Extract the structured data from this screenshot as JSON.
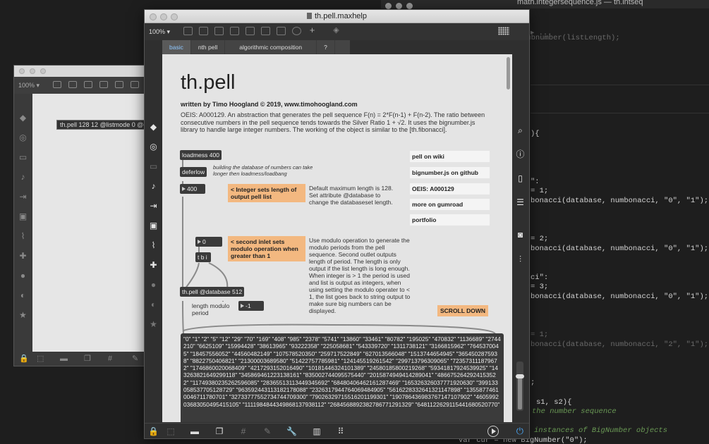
{
  "code_editor": {
    "title": "math.integersequence.js — th.intseq",
    "lines": [
      {
        "text": "▸ ..."
      },
      {
        "text": "'ubnumber(listLength);"
      },
      {
        "text": "){"
      },
      {
        "text": "\":"
      },
      {
        "text": "= 1;"
      },
      {
        "text": "bonacci(database, numbonacci, \"0\", \"1\");"
      },
      {
        "text": "= 2;"
      },
      {
        "text": "bonacci(database, numbonacci, \"0\", \"1\");"
      },
      {
        "text": "ci\":"
      },
      {
        "text": "= 3;"
      },
      {
        "text": "bonacci(database, numbonacci, \"0\", \"1\");"
      },
      {
        "text": "= 1;"
      },
      {
        "text": "bonacci(database, numbonacci, \"2\", \"1\");"
      },
      {
        "text": ";"
      },
      {
        "text": "s1, s2){"
      },
      {
        "text": "the number sequence"
      },
      {
        "text": "instances of BigNumber objects"
      },
      {
        "text": "var cur = new BigNumber(\"0\");"
      }
    ]
  },
  "back_window": {
    "zoom": "100% ▾",
    "object_text": "th.pell 128 12 @listmode 0 @c"
  },
  "help_window": {
    "title": "th.pell.maxhelp",
    "zoom": "100% ▾",
    "tabs": [
      {
        "label": "basic"
      },
      {
        "label": "nth pell"
      },
      {
        "label": "algorithmic composition"
      },
      {
        "label": "?"
      }
    ],
    "canvas": {
      "heading": "th.pell",
      "byline": "written by Timo Hoogland © 2019, www.timohoogland.com",
      "description": "OEIS: A000129. An abstraction that generates the pell sequence F(n) = 2*F(n-1) + F(n-2). The ratio between consecutive numbers in the pell sequence tends towards the Silver Ratio 1 + √2. It uses the bignumber.js library to handle large integer numbers. The working of the object is similar to the [th.fibonacci].",
      "loadmess": "loadmess 400",
      "deferlow": "deferlow",
      "defer_note": "building the database of numbers can take longer then loadmess/loadbang",
      "num_400": "400",
      "integer_comment": "< Integer sets length of output pell list",
      "integer_note": "Default maximum length is 128. Set attribute @database to change the databaseset length.",
      "num_0": "0",
      "tbi": "t b i",
      "modulo_comment": "< second inlet sets modulo operation when greater than 1",
      "modulo_note": "Use modulo operation to generate the modulo periods from the pell sequence. Second outlet outputs length of period. The length is only output if the list length is long enough. When integer is > 1 the period is used and list is output as integers, when using setting the modulo operater to < 1, the list goes back to string output to make sure big numbers can be displayed.",
      "main_object": "th.pell @database 512",
      "length_label": "length modulo period",
      "num_neg1": "-1",
      "links": [
        {
          "label": "pell on wiki"
        },
        {
          "label": "bignumber.js on github"
        },
        {
          "label": "OEIS: A000129"
        },
        {
          "label": "more on gumroad"
        },
        {
          "label": "portfolio"
        }
      ],
      "scroll_down": "SCROLL DOWN",
      "output": "\"0\" \"1\" \"2\" \"5\" \"12\" \"29\" \"70\" \"169\" \"408\" \"985\" \"2378\" \"5741\" \"13860\" \"33461\" \"80782\" \"195025\" \"470832\" \"1136689\" \"2744210\" \"6625109\" \"15994428\" \"38613965\" \"93222358\" \"225058681\" \"543339720\" \"1311738121\" \"3166815962\" \"7645370045\" \"18457556052\" \"44560482149\" \"107578520350\" \"259717522849\" \"627013566048\" \"1513744654945\" \"3654502875938\" \"8822750406821\" \"21300003689580\" \"51422757785981\" \"124145519261542\" \"299713796309065\" \"723573111879672\" \"1746860020068409\" \"4217293152016490\" \"10181446324101389\" \"24580185800219268\" \"59341817924539925\" \"143263821649299118\" \"345869461223138161\" \"835002744095575440\" \"2015874949414289041\" \"4866752642924153522\" \"11749380235262596085\" \"28365513113449345692\" \"68480406462161287469\" \"165326326037771920630\" \"399133058537705128729\" \"963592443113182178088\" \"2326317944764069484905\" \"5616228332641321147898\" \"13558774610046711780701\" \"32733777552734744709300\" \"79026329715516201199301\" \"190786436983767147107902\" \"460599203683050495415105\" \"1111984844349868137938112\" \"2684568892382786771291329\" \"6481122629115441680520770\""
    }
  }
}
